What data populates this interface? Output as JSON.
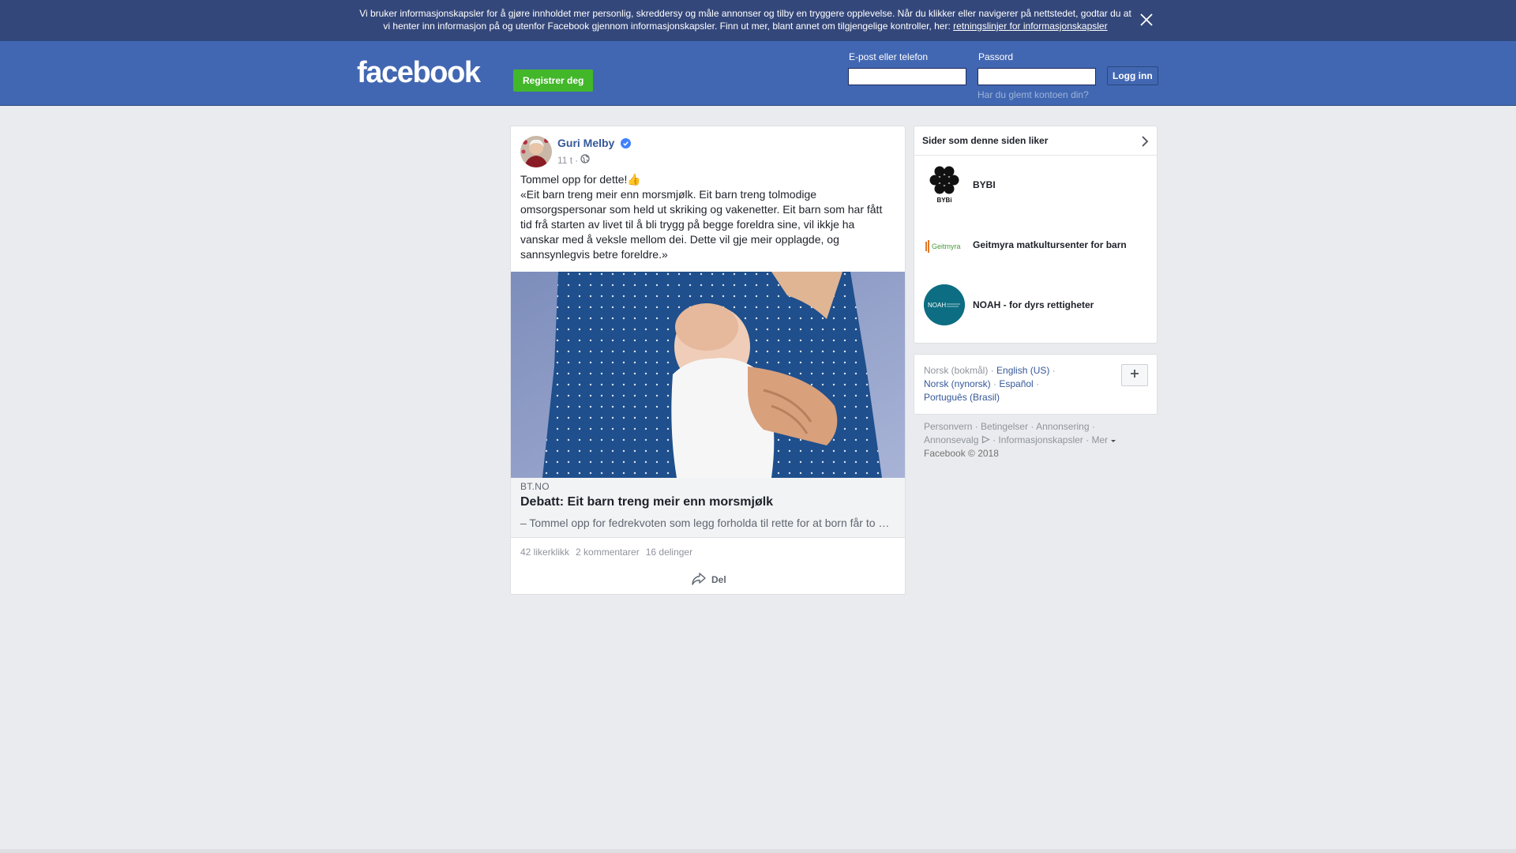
{
  "cookie_banner": {
    "text": "Vi bruker informasjonskapsler for å gjøre innholdet mer personlig, skreddersy og måle annonser og tilby en tryggere opplevelse. Når du klikker eller navigerer på nettstedet, godtar du at vi henter inn informasjon på og utenfor Facebook gjennom informasjonskapsler. Finn ut mer, blant annet om tilgjengelige kontroller, her:",
    "link_text": "retningslinjer for informasjonskapsler",
    "close_icon": "close-icon"
  },
  "header": {
    "logo": "facebook",
    "register_label": "Registrer deg",
    "email_label": "E-post eller telefon",
    "email_value": "",
    "password_label": "Passord",
    "password_value": "",
    "login_label": "Logg inn",
    "forgot_label": "Har du glemt kontoen din?"
  },
  "post": {
    "author": "Guri Melby",
    "time": "11 t",
    "text_line1": "Tommel opp for dette!👍",
    "text_quote": "«Eit barn treng meir enn morsmjølk. Eit barn treng tolmodige omsorgspersonar som held ut skriking og vakenetter. Eit barn som har fått tid frå starten av livet til å bli trygg på begge foreldra sine, vil ikkje ha vanskar med å veksle mellom dei. Dette vil gje meir opplagde, og sannsynlegvis betre foreldre.»",
    "link": {
      "source": "BT.NO",
      "title": "Debatt: Eit barn treng meir enn morsmjølk",
      "description": "– Tommel opp for fedrekvoten som legg forholda til rette for at born får to trygge foreldre."
    },
    "stats": {
      "likes": "42 likerklikk",
      "comments": "2 kommentarer",
      "shares": "16 delinger"
    },
    "share_label": "Del"
  },
  "sidebar": {
    "pages_title": "Sider som denne siden liker",
    "pages": [
      {
        "name": "BYBI"
      },
      {
        "name": "Geitmyra matkultursenter for barn"
      },
      {
        "name": "NOAH - for dyrs rettigheter"
      }
    ],
    "bybi_logo_text": "BYBi",
    "geitmyra_logo_text": "Geitmyra",
    "noah_logo_text": "NOAH",
    "languages": {
      "current": "Norsk (bokmål)",
      "items": [
        "English (US)",
        "Norsk (nynorsk)",
        "Español",
        "Português (Brasil)"
      ]
    },
    "footer": {
      "links": [
        "Personvern",
        "Betingelser",
        "Annonsering",
        "Annonsevalg",
        "Informasjonskapsler",
        "Mer"
      ],
      "copyright": "Facebook © 2018"
    }
  },
  "colors": {
    "header_bg": "#4267b2",
    "banner_bg": "#34477a",
    "register_green": "#42b72a",
    "link_blue": "#365899"
  }
}
